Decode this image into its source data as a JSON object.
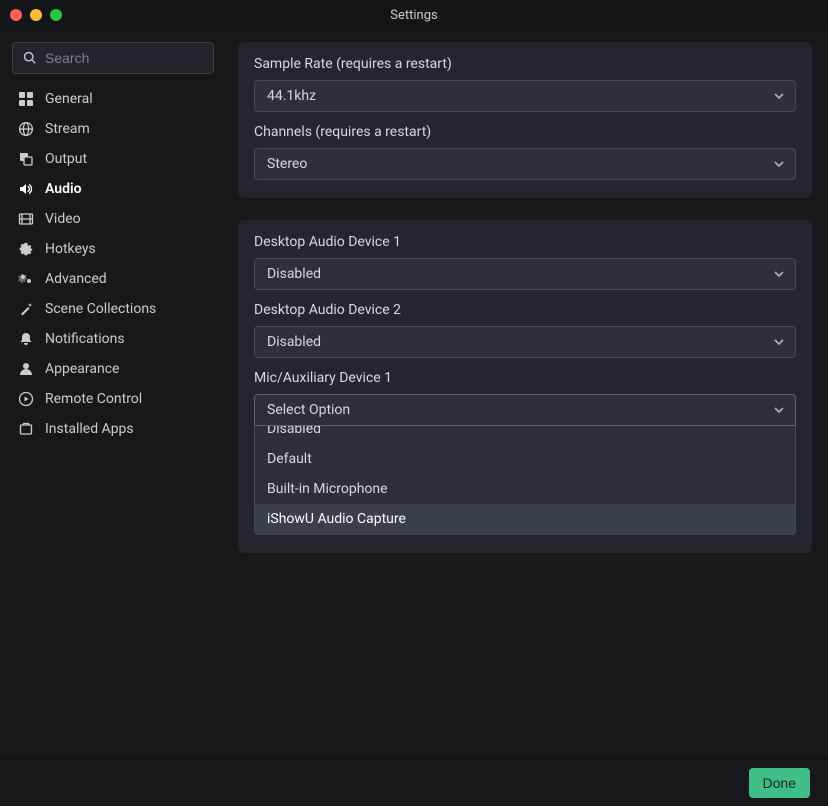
{
  "window": {
    "title": "Settings"
  },
  "search": {
    "placeholder": "Search"
  },
  "sidebar": {
    "items": [
      {
        "label": "General"
      },
      {
        "label": "Stream"
      },
      {
        "label": "Output"
      },
      {
        "label": "Audio"
      },
      {
        "label": "Video"
      },
      {
        "label": "Hotkeys"
      },
      {
        "label": "Advanced"
      },
      {
        "label": "Scene Collections"
      },
      {
        "label": "Notifications"
      },
      {
        "label": "Appearance"
      },
      {
        "label": "Remote Control"
      },
      {
        "label": "Installed Apps"
      }
    ],
    "active_index": 3
  },
  "sections": {
    "sample_rate": {
      "label": "Sample Rate (requires a restart)",
      "value": "44.1khz"
    },
    "channels": {
      "label": "Channels (requires a restart)",
      "value": "Stereo"
    },
    "desktop1": {
      "label": "Desktop Audio Device 1",
      "value": "Disabled"
    },
    "desktop2": {
      "label": "Desktop Audio Device 2",
      "value": "Disabled"
    },
    "mic1": {
      "label": "Mic/Auxiliary Device 1",
      "value": "Select Option",
      "options": [
        "Disabled",
        "Default",
        "Built-in Microphone",
        "iShowU Audio Capture"
      ],
      "highlight_index": 3
    }
  },
  "footer": {
    "done": "Done"
  }
}
